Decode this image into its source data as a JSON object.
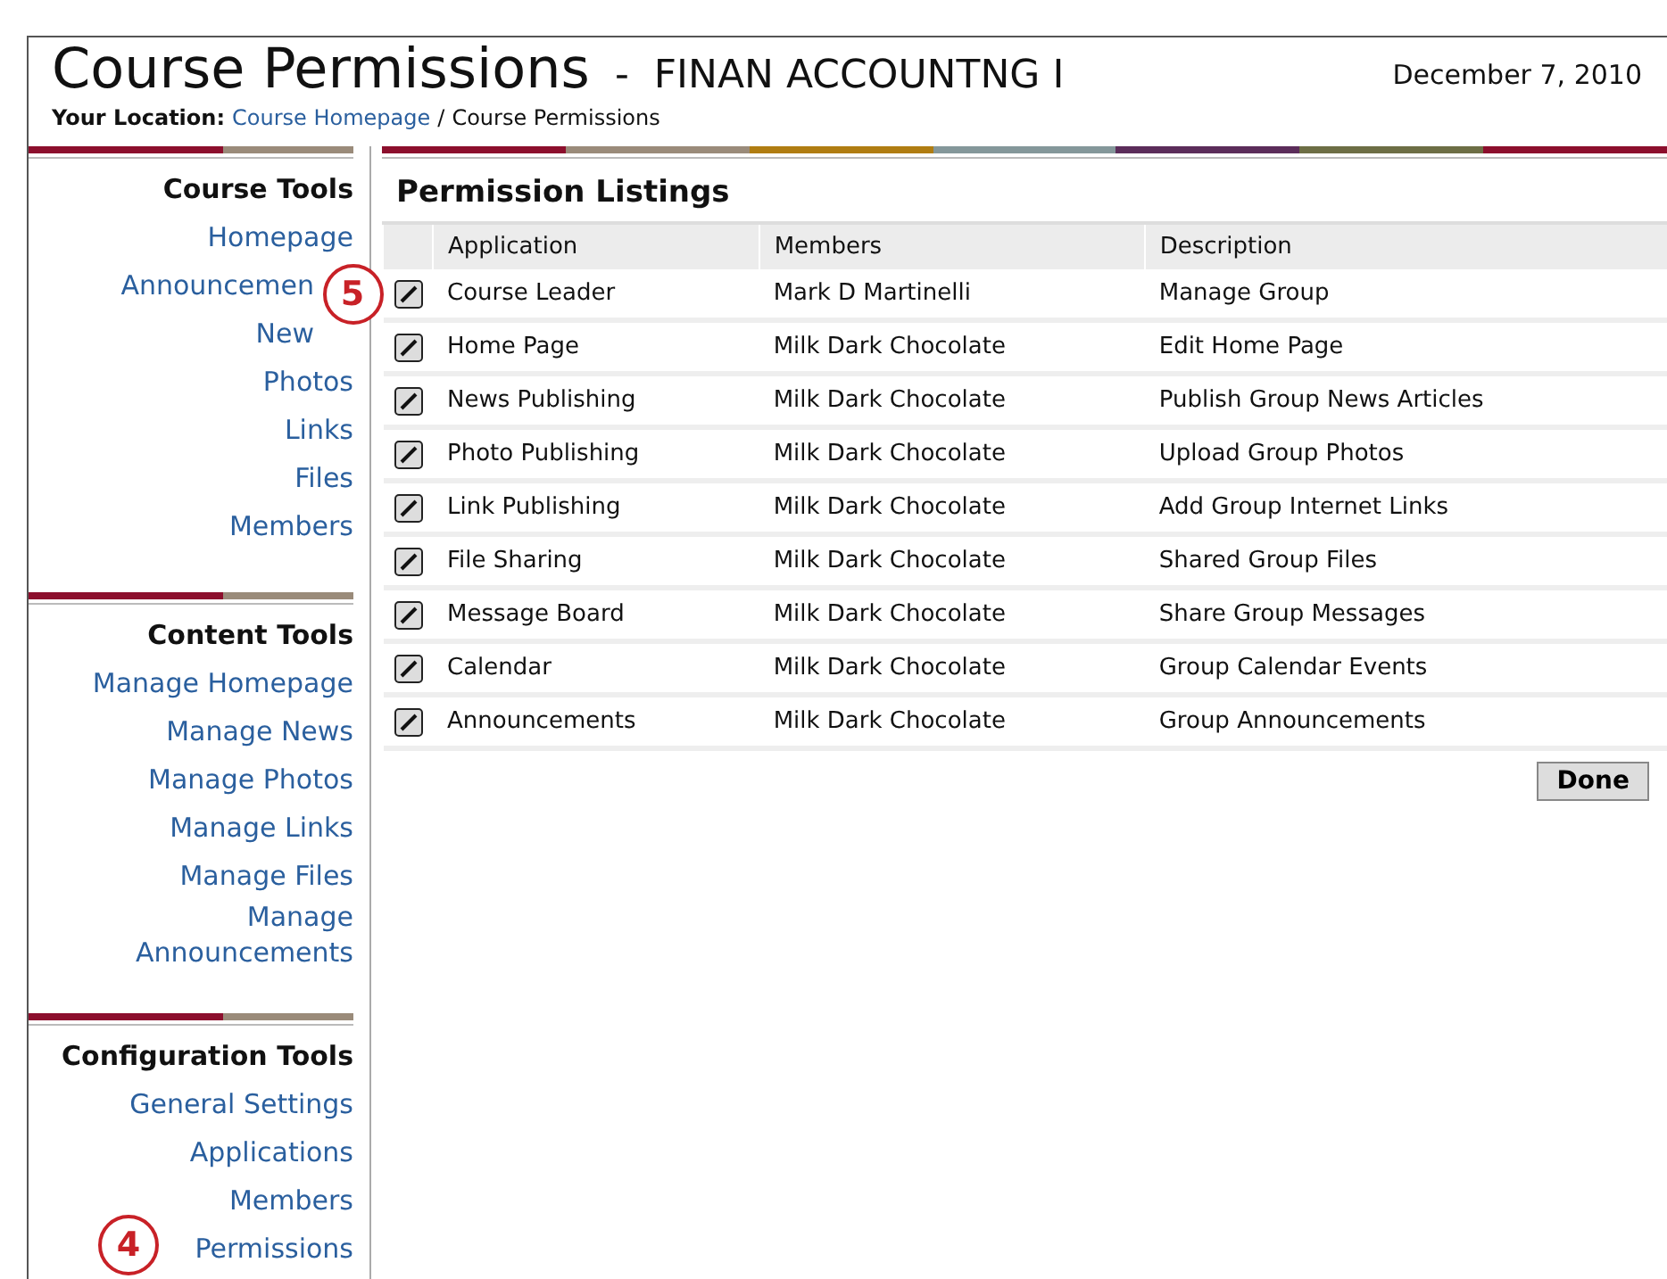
{
  "header": {
    "title": "Course Permissions",
    "separator": "-",
    "course": "FINAN ACCOUNTNG I",
    "date": "December 7, 2010",
    "location_label": "Your Location:",
    "breadcrumb": [
      {
        "label": "Course Homepage",
        "link": true
      },
      {
        "label": "/",
        "link": false
      },
      {
        "label": "Course Permissions",
        "link": false
      }
    ]
  },
  "sidebar": [
    {
      "title": "Course Tools",
      "items": [
        {
          "label": "Homepage"
        },
        {
          "label": "Announcemen",
          "covered": true
        },
        {
          "label": "New",
          "covered": true
        },
        {
          "label": "Photos"
        },
        {
          "label": "Links"
        },
        {
          "label": "Files"
        },
        {
          "label": "Members"
        }
      ]
    },
    {
      "title": "Content Tools",
      "items": [
        {
          "label": "Manage Homepage"
        },
        {
          "label": "Manage News"
        },
        {
          "label": "Manage Photos"
        },
        {
          "label": "Manage Links"
        },
        {
          "label": "Manage Files"
        },
        {
          "label": "Manage Announcements"
        }
      ]
    },
    {
      "title": "Configuration Tools",
      "items": [
        {
          "label": "General Settings"
        },
        {
          "label": "Applications"
        },
        {
          "label": "Members"
        },
        {
          "label": "Permissions",
          "callout": "4"
        }
      ]
    }
  ],
  "main": {
    "title": "Permission Listings",
    "table": {
      "columns": [
        "Application",
        "Members",
        "Description"
      ],
      "rows": [
        {
          "cells": [
            "Course Leader",
            "Mark D Martinelli",
            "Manage Group"
          ],
          "callout": "5"
        },
        {
          "cells": [
            "Home Page",
            "Milk Dark Chocolate",
            "Edit Home Page"
          ]
        },
        {
          "cells": [
            "News Publishing",
            "Milk Dark Chocolate",
            "Publish Group News Articles"
          ]
        },
        {
          "cells": [
            "Photo Publishing",
            "Milk Dark Chocolate",
            "Upload Group Photos"
          ]
        },
        {
          "cells": [
            "Link Publishing",
            "Milk Dark Chocolate",
            "Add Group Internet Links"
          ]
        },
        {
          "cells": [
            "File Sharing",
            "Milk Dark Chocolate",
            "Shared Group Files"
          ]
        },
        {
          "cells": [
            "Message Board",
            "Milk Dark Chocolate",
            "Share Group Messages"
          ]
        },
        {
          "cells": [
            "Calendar",
            "Milk Dark Chocolate",
            "Group Calendar Events"
          ]
        },
        {
          "cells": [
            "Announcements",
            "Milk Dark Chocolate",
            "Group Announcements"
          ]
        }
      ]
    },
    "button": "Done"
  }
}
